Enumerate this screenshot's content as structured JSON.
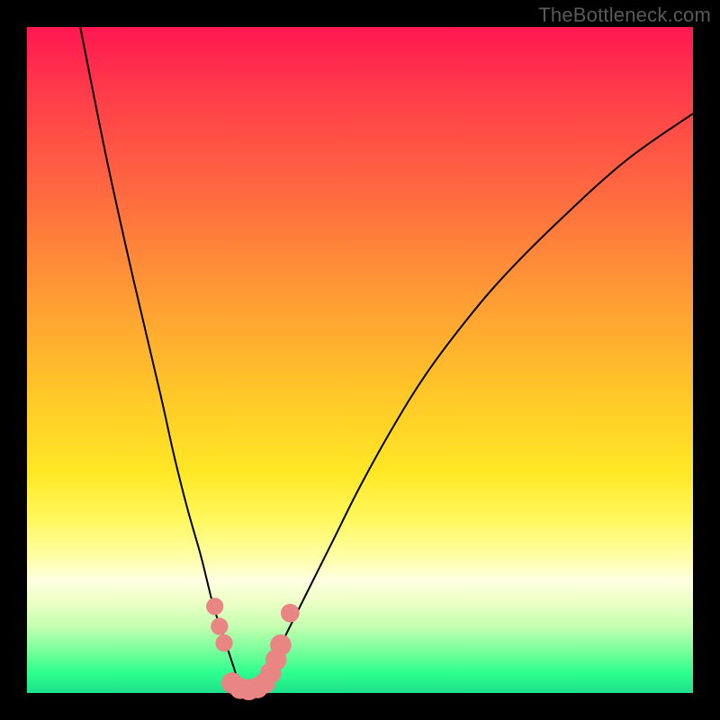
{
  "watermark": "TheBottleneck.com",
  "colors": {
    "frame": "#000000",
    "curve": "#000000",
    "marker": "#e98583",
    "gradient_stops": [
      "#ff1750",
      "#ff3c4a",
      "#ff6a40",
      "#ff9a35",
      "#ffc728",
      "#ffe826",
      "#fff85e",
      "#ffffad",
      "#ffffe2",
      "#f0ffc8",
      "#c4ffb0",
      "#71ff9a",
      "#2dff8e",
      "#1fe08c"
    ]
  },
  "chart_data": {
    "type": "line",
    "title": "",
    "xlabel": "",
    "ylabel": "",
    "xlim": [
      0,
      100
    ],
    "ylim": [
      0,
      100
    ],
    "note": "V-shaped bottleneck curve; minimum reaches y≈0 near x≈33. Values read from pixel geometry on a 0–100 normalized axis (no tick labels present).",
    "series": [
      {
        "name": "left-branch",
        "x": [
          8,
          12,
          16,
          20,
          22,
          24,
          26,
          27,
          28,
          29,
          30,
          31,
          32,
          33
        ],
        "values": [
          100,
          80,
          62,
          45,
          36,
          28,
          21,
          17,
          13,
          10,
          7,
          4,
          1,
          0
        ]
      },
      {
        "name": "right-branch",
        "x": [
          33,
          35,
          37,
          39,
          42,
          46,
          50,
          55,
          60,
          66,
          72,
          80,
          90,
          100
        ],
        "values": [
          0,
          2,
          5,
          9,
          15,
          23,
          31,
          40,
          48,
          56,
          63,
          71,
          80,
          87
        ]
      }
    ],
    "markers": {
      "name": "bottom-cluster",
      "color": "#e98583",
      "points": [
        {
          "x": 28.2,
          "y": 13.0,
          "r": 1.3
        },
        {
          "x": 28.9,
          "y": 10.0,
          "r": 1.3
        },
        {
          "x": 29.6,
          "y": 7.5,
          "r": 1.3
        },
        {
          "x": 30.8,
          "y": 1.5,
          "r": 1.6
        },
        {
          "x": 32.0,
          "y": 0.7,
          "r": 1.6
        },
        {
          "x": 33.3,
          "y": 0.5,
          "r": 1.6
        },
        {
          "x": 34.6,
          "y": 0.8,
          "r": 1.6
        },
        {
          "x": 35.7,
          "y": 1.5,
          "r": 1.6
        },
        {
          "x": 36.6,
          "y": 3.0,
          "r": 1.6
        },
        {
          "x": 37.4,
          "y": 5.0,
          "r": 1.6
        },
        {
          "x": 38.1,
          "y": 7.2,
          "r": 1.6
        },
        {
          "x": 39.5,
          "y": 12.0,
          "r": 1.4
        }
      ]
    }
  }
}
